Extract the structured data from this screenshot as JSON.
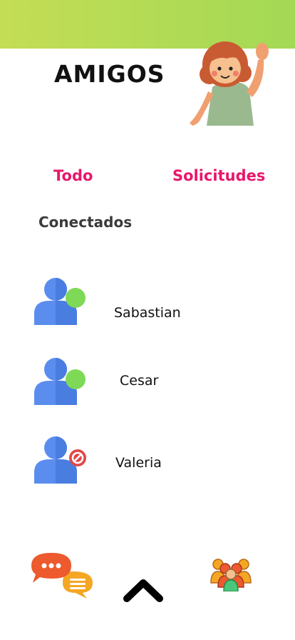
{
  "header": {
    "title": "AMIGOS"
  },
  "tabs": [
    {
      "label": "Todo"
    },
    {
      "label": "Solicitudes"
    }
  ],
  "section": {
    "title": "Conectados"
  },
  "friends": [
    {
      "name": "Sabastian",
      "status": "online",
      "status_color": "#7ed957"
    },
    {
      "name": "Cesar",
      "status": "online",
      "status_color": "#7ed957"
    },
    {
      "name": "Valeria",
      "status": "blocked",
      "status_color": "#e04848"
    }
  ],
  "bottom_nav": [
    {
      "icon": "chat-bubbles-icon"
    },
    {
      "icon": "chevron-up-icon"
    },
    {
      "icon": "group-icon"
    }
  ],
  "colors": {
    "accent": "#e8176b",
    "band": "#b5db55",
    "avatar_blue": "#5b8def"
  }
}
